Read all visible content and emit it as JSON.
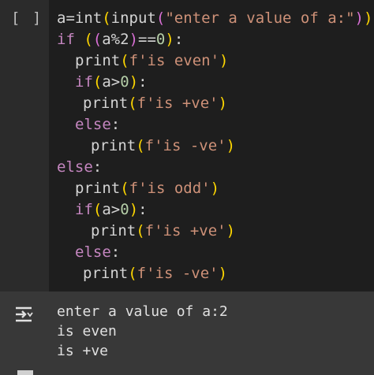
{
  "cell": {
    "run_label": "[ ]",
    "lines": [
      {
        "parts": [
          {
            "t": "a=",
            "c": ""
          },
          {
            "t": "int",
            "c": "kw-builtin"
          },
          {
            "t": "(",
            "c": "paren-1"
          },
          {
            "t": "input",
            "c": ""
          },
          {
            "t": "(",
            "c": "paren-2"
          },
          {
            "t": "\"enter a value of a:\"",
            "c": "str"
          },
          {
            "t": ")",
            "c": "paren-2"
          },
          {
            "t": ")",
            "c": "paren-1"
          }
        ]
      },
      {
        "parts": [
          {
            "t": "if ",
            "c": "kw-control"
          },
          {
            "t": "(",
            "c": "paren-1"
          },
          {
            "t": "(",
            "c": "paren-2"
          },
          {
            "t": "a%2",
            "c": ""
          },
          {
            "t": ")",
            "c": "paren-2"
          },
          {
            "t": "==",
            "c": ""
          },
          {
            "t": "0",
            "c": "num"
          },
          {
            "t": ")",
            "c": "paren-1"
          },
          {
            "t": ":",
            "c": ""
          }
        ]
      },
      {
        "parts": [
          {
            "t": "print",
            "c": ""
          },
          {
            "t": "(",
            "c": "paren-1"
          },
          {
            "t": "f'is even'",
            "c": "str"
          },
          {
            "t": ")",
            "c": "paren-1"
          }
        ]
      },
      {
        "parts": [
          {
            "t": "if",
            "c": "kw-control"
          },
          {
            "t": "(",
            "c": "paren-1"
          },
          {
            "t": "a>",
            "c": ""
          },
          {
            "t": "0",
            "c": "num"
          },
          {
            "t": ")",
            "c": "paren-1"
          },
          {
            "t": ":",
            "c": ""
          }
        ]
      },
      {
        "parts": [
          {
            "t": "print",
            "c": ""
          },
          {
            "t": "(",
            "c": "paren-1"
          },
          {
            "t": "f'is +ve'",
            "c": "str"
          },
          {
            "t": ")",
            "c": "paren-1"
          }
        ]
      },
      {
        "parts": [
          {
            "t": "else",
            "c": "kw-control"
          },
          {
            "t": ":",
            "c": ""
          }
        ]
      },
      {
        "parts": [
          {
            "t": "print",
            "c": ""
          },
          {
            "t": "(",
            "c": "paren-1"
          },
          {
            "t": "f'is -ve'",
            "c": "str"
          },
          {
            "t": ")",
            "c": "paren-1"
          }
        ]
      },
      {
        "parts": [
          {
            "t": "else",
            "c": "kw-control"
          },
          {
            "t": ":",
            "c": ""
          }
        ]
      },
      {
        "parts": [
          {
            "t": "print",
            "c": ""
          },
          {
            "t": "(",
            "c": "paren-1"
          },
          {
            "t": "f'is odd'",
            "c": "str"
          },
          {
            "t": ")",
            "c": "paren-1"
          }
        ]
      },
      {
        "parts": [
          {
            "t": "if",
            "c": "kw-control"
          },
          {
            "t": "(",
            "c": "paren-1"
          },
          {
            "t": "a>",
            "c": ""
          },
          {
            "t": "0",
            "c": "num"
          },
          {
            "t": ")",
            "c": "paren-1"
          },
          {
            "t": ":",
            "c": ""
          }
        ]
      },
      {
        "parts": [
          {
            "t": "print",
            "c": ""
          },
          {
            "t": "(",
            "c": "paren-1"
          },
          {
            "t": "f'is +ve'",
            "c": "str"
          },
          {
            "t": ")",
            "c": "paren-1"
          }
        ]
      },
      {
        "parts": [
          {
            "t": "else",
            "c": "kw-control"
          },
          {
            "t": ":",
            "c": ""
          }
        ]
      },
      {
        "parts": [
          {
            "t": "print",
            "c": ""
          },
          {
            "t": "(",
            "c": "paren-1"
          },
          {
            "t": "f'is -ve'",
            "c": "str"
          },
          {
            "t": ")",
            "c": "paren-1"
          }
        ]
      }
    ]
  },
  "output": {
    "icon": "output-toggle-icon",
    "lines": [
      "enter a value of a:2",
      "is even",
      "is +ve"
    ]
  },
  "colors": {
    "code_background": "#1e1e1e",
    "output_background": "#383838",
    "keyword": "#c586c0",
    "string": "#ce9178",
    "number": "#b5cea8",
    "bracket_level_1": "#ffd700",
    "bracket_level_2": "#da70d6"
  }
}
